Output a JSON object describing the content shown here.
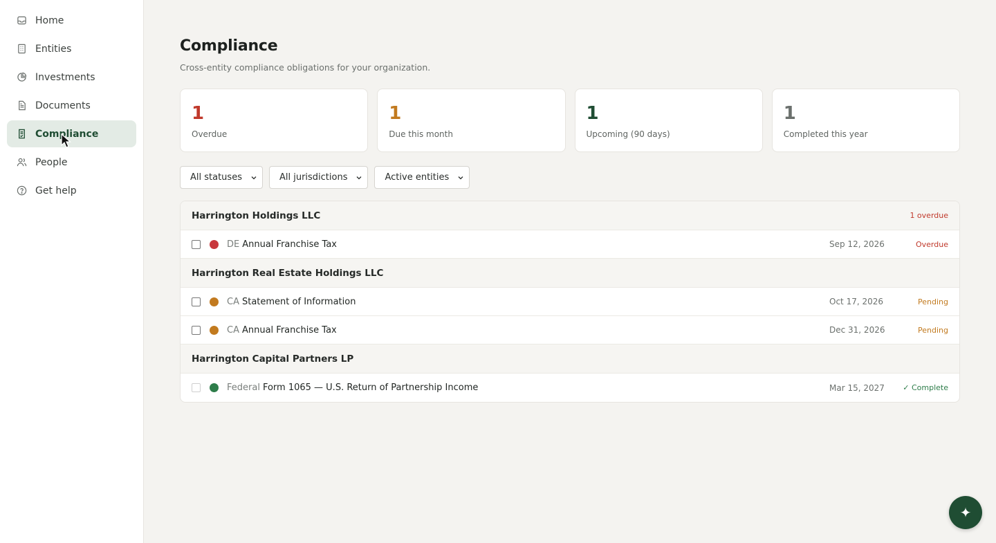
{
  "sidebar": {
    "items": [
      {
        "label": "Home",
        "icon": "inbox-icon"
      },
      {
        "label": "Entities",
        "icon": "building-icon"
      },
      {
        "label": "Investments",
        "icon": "pie-chart-icon"
      },
      {
        "label": "Documents",
        "icon": "document-icon"
      },
      {
        "label": "Compliance",
        "icon": "checklist-icon",
        "active": true
      },
      {
        "label": "People",
        "icon": "people-icon"
      },
      {
        "label": "Get help",
        "icon": "help-circle-icon"
      }
    ]
  },
  "header": {
    "title": "Compliance",
    "subtitle": "Cross-entity compliance obligations for your organization."
  },
  "stats": [
    {
      "value": "1",
      "label": "Overdue",
      "color": "#c0392b"
    },
    {
      "value": "1",
      "label": "Due this month",
      "color": "#c27a1f"
    },
    {
      "value": "1",
      "label": "Upcoming (90 days)",
      "color": "#1f4d33"
    },
    {
      "value": "1",
      "label": "Completed this year",
      "color": "#6b706d"
    }
  ],
  "filters": {
    "status": "All statuses",
    "jurisdiction": "All jurisdictions",
    "entities": "Active entities"
  },
  "groups": [
    {
      "name": "Harrington Holdings LLC",
      "badge": "1 overdue",
      "rows": [
        {
          "jurisdiction": "DE",
          "name": "Annual Franchise Tax",
          "date": "Sep 12, 2026",
          "status": "Overdue",
          "status_color": "#c0392b",
          "dot_color": "#c8373c"
        }
      ]
    },
    {
      "name": "Harrington Real Estate Holdings LLC",
      "badge": "",
      "rows": [
        {
          "jurisdiction": "CA",
          "name": "Statement of Information",
          "date": "Oct 17, 2026",
          "status": "Pending",
          "status_color": "#c27a1f",
          "dot_color": "#c27a1f"
        },
        {
          "jurisdiction": "CA",
          "name": "Annual Franchise Tax",
          "date": "Dec 31, 2026",
          "status": "Pending",
          "status_color": "#c27a1f",
          "dot_color": "#c27a1f"
        }
      ]
    },
    {
      "name": "Harrington Capital Partners LP",
      "badge": "",
      "rows": [
        {
          "jurisdiction": "Federal",
          "name": "Form 1065 — U.S. Return of Partnership Income",
          "date": "Mar 15, 2027",
          "status": "✓ Complete",
          "status_color": "#2e7d4a",
          "dot_color": "#2e7d4a"
        }
      ]
    }
  ],
  "fab": {
    "icon": "sparkle-icon",
    "glyph": "✦"
  }
}
